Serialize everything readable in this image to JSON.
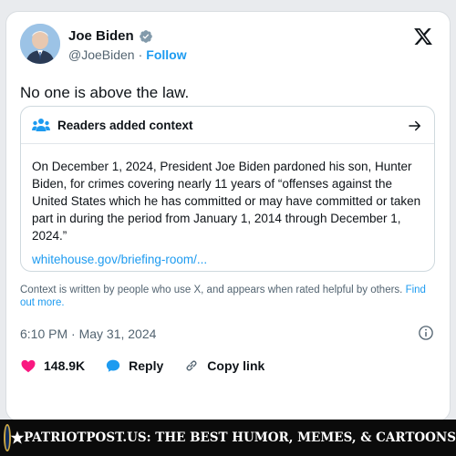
{
  "tweet": {
    "display_name": "Joe Biden",
    "handle": "@JoeBiden",
    "separator": "·",
    "follow_label": "Follow",
    "text": "No one is above the law.",
    "timestamp": "6:10 PM · May 31, 2024"
  },
  "context": {
    "title": "Readers added context",
    "body": "On December 1, 2024, President Joe Biden pardoned his son, Hunter Biden, for crimes covering nearly 11 years of “offenses against the United States which he has committed or may have committed or taken part in during the period from January 1, 2014 through December 1, 2024.”",
    "link": "whitehouse.gov/briefing-room/...",
    "note": "Context is written by people who use X, and appears when rated helpful by others.",
    "find_out_more": "Find out more."
  },
  "actions": {
    "likes": "148.9K",
    "reply_label": "Reply",
    "copy_label": "Copy link"
  },
  "footer": {
    "text": ". PATRIOTPOST.US: THE BEST HUMOR, MEMES, & CARTOONS"
  },
  "colors": {
    "accent": "#1d9bf0",
    "like": "#f91880",
    "verified_badge": "#829aab",
    "muted_text": "#536471"
  },
  "icons": [
    "verified-badge-icon",
    "x-logo-icon",
    "people-icon",
    "arrow-right-icon",
    "info-icon",
    "heart-icon",
    "reply-icon",
    "link-icon",
    "seal-icon"
  ]
}
